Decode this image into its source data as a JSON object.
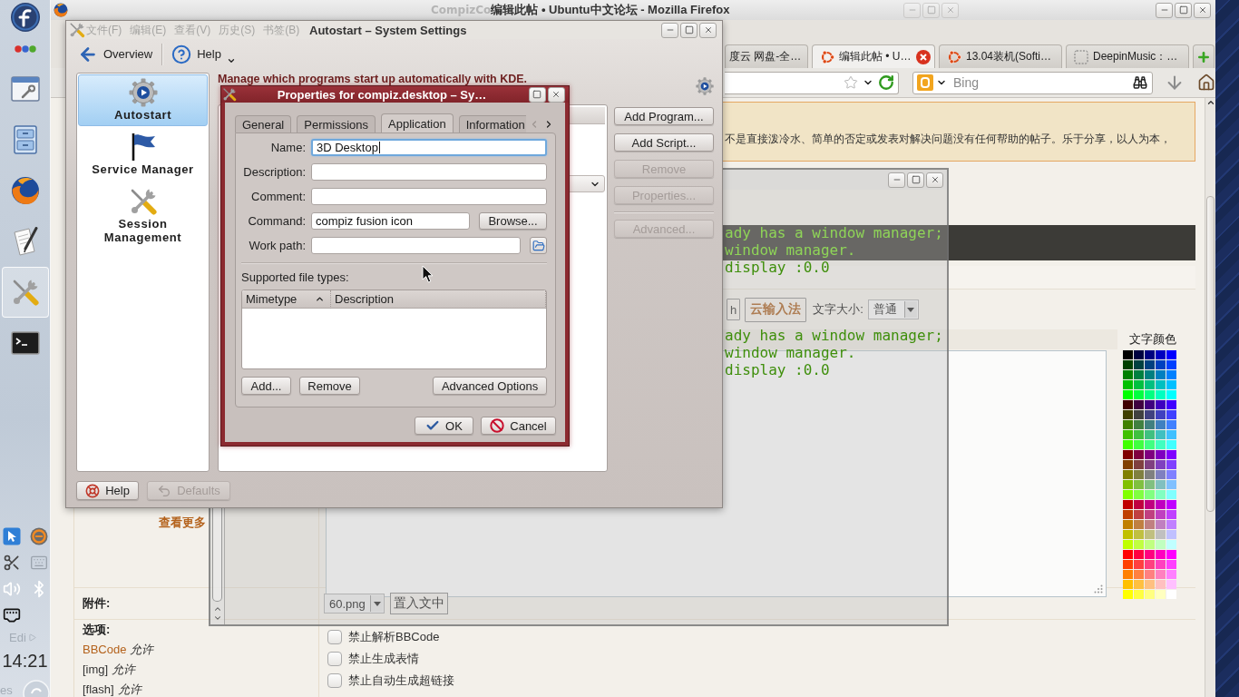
{
  "dock": {
    "launchers": [
      {
        "selected": false
      },
      {
        "selected": false
      },
      {
        "selected": false
      },
      {
        "selected": false
      },
      {
        "selected": true
      },
      {
        "selected": false
      }
    ],
    "faded_labels": [
      "Edi",
      "es"
    ],
    "clock": "14:21"
  },
  "firefox": {
    "ghost_title": "CompizCo",
    "title": "编辑此帖 • Ubuntu中文论坛 - Mozilla Firefox",
    "menu": [
      "文件(F)",
      "编辑(E)",
      "查看(V)",
      "历史(S)",
      "书签(B)"
    ],
    "tabs": [
      {
        "label": "度云 网盘-全…",
        "selected": false
      },
      {
        "label": "编辑此帖 • U…",
        "selected": true
      },
      {
        "label": "13.04装机(Softi…",
        "selected": false
      },
      {
        "label": "DeepinMusic：…",
        "selected": false
      }
    ],
    "search": {
      "placeholder": "Bing"
    },
    "page": {
      "notice": "不是直接泼冷水、简单的否定或发表对解决问题没有任何帮助的帖子。乐于分享，以人为本，",
      "more_link": "查看更多",
      "editor": {
        "toolbar_buttons": [
          {
            "label": "h",
            "kind": "plain"
          },
          {
            "label": "云输入法",
            "kind": "accent"
          }
        ],
        "font_size": {
          "label": "文字大小:",
          "value": "普通"
        },
        "color_label": "文字颜色",
        "swatches": [
          {
            "color": "#000000"
          },
          {
            "color": "#000040"
          },
          {
            "color": "#000080"
          },
          {
            "color": "#0000c0"
          },
          {
            "color": "#0000ff"
          },
          {
            "color": "#004000"
          },
          {
            "color": "#004040"
          },
          {
            "color": "#004080"
          },
          {
            "color": "#0040c0"
          },
          {
            "color": "#0040ff"
          },
          {
            "color": "#008000"
          },
          {
            "color": "#008040"
          },
          {
            "color": "#008080"
          },
          {
            "color": "#0080c0"
          },
          {
            "color": "#0080ff"
          },
          {
            "color": "#00c000"
          },
          {
            "color": "#00c040"
          },
          {
            "color": "#00c080"
          },
          {
            "color": "#00c0c0"
          },
          {
            "color": "#00c0ff"
          },
          {
            "color": "#00ff00"
          },
          {
            "color": "#00ff40"
          },
          {
            "color": "#00ff80"
          },
          {
            "color": "#00ffc0"
          },
          {
            "color": "#00ffff"
          },
          {
            "color": "#400000"
          },
          {
            "color": "#400040"
          },
          {
            "color": "#400080"
          },
          {
            "color": "#4000c0"
          },
          {
            "color": "#4000ff"
          },
          {
            "color": "#404000"
          },
          {
            "color": "#404040"
          },
          {
            "color": "#404080"
          },
          {
            "color": "#4040c0"
          },
          {
            "color": "#4040ff"
          },
          {
            "color": "#408000"
          },
          {
            "color": "#408040"
          },
          {
            "color": "#408080"
          },
          {
            "color": "#4080c0"
          },
          {
            "color": "#4080ff"
          },
          {
            "color": "#40c000"
          },
          {
            "color": "#40c040"
          },
          {
            "color": "#40c080"
          },
          {
            "color": "#40c0c0"
          },
          {
            "color": "#40c0ff"
          },
          {
            "color": "#40ff00"
          },
          {
            "color": "#40ff40"
          },
          {
            "color": "#40ff80"
          },
          {
            "color": "#40ffc0"
          },
          {
            "color": "#40ffff"
          },
          {
            "color": "#800000"
          },
          {
            "color": "#800040"
          },
          {
            "color": "#800080"
          },
          {
            "color": "#8000c0"
          },
          {
            "color": "#8000ff"
          },
          {
            "color": "#804000"
          },
          {
            "color": "#804040"
          },
          {
            "color": "#804080"
          },
          {
            "color": "#8040c0"
          },
          {
            "color": "#8040ff"
          },
          {
            "color": "#808000"
          },
          {
            "color": "#808040"
          },
          {
            "color": "#808080"
          },
          {
            "color": "#8080c0"
          },
          {
            "color": "#8080ff"
          },
          {
            "color": "#80c000"
          },
          {
            "color": "#80c040"
          },
          {
            "color": "#80c080"
          },
          {
            "color": "#80c0c0"
          },
          {
            "color": "#80c0ff"
          },
          {
            "color": "#80ff00"
          },
          {
            "color": "#80ff40"
          },
          {
            "color": "#80ff80"
          },
          {
            "color": "#80ffc0"
          },
          {
            "color": "#80ffff"
          },
          {
            "color": "#c00000"
          },
          {
            "color": "#c00040"
          },
          {
            "color": "#c00080"
          },
          {
            "color": "#c000c0"
          },
          {
            "color": "#c000ff"
          },
          {
            "color": "#c04000"
          },
          {
            "color": "#c04040"
          },
          {
            "color": "#c04080"
          },
          {
            "color": "#c040c0"
          },
          {
            "color": "#c040ff"
          },
          {
            "color": "#c08000"
          },
          {
            "color": "#c08040"
          },
          {
            "color": "#c08080"
          },
          {
            "color": "#c080c0"
          },
          {
            "color": "#c080ff"
          },
          {
            "color": "#c0c000"
          },
          {
            "color": "#c0c040"
          },
          {
            "color": "#c0c080"
          },
          {
            "color": "#c0c0c0"
          },
          {
            "color": "#c0c0ff"
          },
          {
            "color": "#c0ff00"
          },
          {
            "color": "#c0ff40"
          },
          {
            "color": "#c0ff80"
          },
          {
            "color": "#c0ffc0"
          },
          {
            "color": "#c0ffff"
          },
          {
            "color": "#ff0000"
          },
          {
            "color": "#ff0040"
          },
          {
            "color": "#ff0080"
          },
          {
            "color": "#ff00c0"
          },
          {
            "color": "#ff00ff"
          },
          {
            "color": "#ff4000"
          },
          {
            "color": "#ff4040"
          },
          {
            "color": "#ff4080"
          },
          {
            "color": "#ff40c0"
          },
          {
            "color": "#ff40ff"
          },
          {
            "color": "#ff8000"
          },
          {
            "color": "#ff8040"
          },
          {
            "color": "#ff8080"
          },
          {
            "color": "#ff80c0"
          },
          {
            "color": "#ff80ff"
          },
          {
            "color": "#ffc000"
          },
          {
            "color": "#ffc040"
          },
          {
            "color": "#ffc080"
          },
          {
            "color": "#ffc0c0"
          },
          {
            "color": "#ffc0ff"
          },
          {
            "color": "#ffff00"
          },
          {
            "color": "#ffff40"
          },
          {
            "color": "#ffff80"
          },
          {
            "color": "#ffffc0"
          },
          {
            "color": "#ffffff"
          }
        ]
      },
      "attachment": {
        "label": "附件:",
        "file": "60.png",
        "button": "置入文中"
      },
      "options": {
        "label": "选项:",
        "items": [
          {
            "tag": "BBCode",
            "status": "允许",
            "link": true
          },
          {
            "tag": "[img]",
            "status": "允许",
            "link": false
          },
          {
            "tag": "[flash]",
            "status": "允许",
            "link": false
          }
        ],
        "checkboxes": [
          {
            "label": "禁止解析BBCode",
            "checked": false
          },
          {
            "label": "禁止生成表情",
            "checked": false
          },
          {
            "label": "禁止自动生成超链接",
            "checked": false
          }
        ]
      }
    }
  },
  "terminal": {
    "text_blocks": [
      {
        "lines": [
          {
            "text": "ady has a window manager;",
            "dimmed": true
          },
          {
            "text": "window manager.",
            "dimmed": true
          },
          {
            "text": "display :0.0",
            "dimmed": false
          }
        ]
      },
      {
        "lines": [
          {
            "text": "ady has a window manager;",
            "dimmed": false
          },
          {
            "text": "window manager.",
            "dimmed": false
          },
          {
            "text": "display :0.0",
            "dimmed": false
          }
        ]
      }
    ]
  },
  "autostart": {
    "title": "Autostart – System Settings",
    "toolbar": [
      "Overview",
      "Help"
    ],
    "sidebar": [
      {
        "label": "Autostart",
        "selected": true
      },
      {
        "label": "Service Manager",
        "selected": false
      },
      {
        "label": "Session Management",
        "selected": false
      }
    ],
    "heading": "Manage which programs start up automatically with KDE.",
    "button_groups": [
      [
        {
          "label": "Add Program...",
          "disabled": false
        },
        {
          "label": "Add Script...",
          "disabled": false
        },
        {
          "label": "Remove",
          "disabled": true
        },
        {
          "label": "Properties...",
          "disabled": true
        }
      ],
      [
        {
          "label": "Advanced...",
          "disabled": true
        }
      ]
    ],
    "footer_buttons": [
      {
        "label": "Help",
        "disabled": false
      },
      {
        "label": "Defaults",
        "disabled": true
      }
    ]
  },
  "properties_dialog": {
    "title": "Properties for compiz.desktop – Sy…",
    "tabs": [
      {
        "label": "General",
        "selected": false
      },
      {
        "label": "Permissions",
        "selected": false
      },
      {
        "label": "Application",
        "selected": true
      },
      {
        "label": "Information",
        "selected": false
      }
    ],
    "tab_scroll": {
      "back_disabled": true,
      "forward_disabled": false
    },
    "fields": [
      {
        "kind": "text",
        "label": "Name:",
        "value": "3D Desktop",
        "focused": true
      },
      {
        "kind": "text",
        "label": "Description:",
        "focused": false
      },
      {
        "kind": "text",
        "label": "Comment:",
        "focused": false
      },
      {
        "kind": "browse",
        "label": "Command:",
        "value": "compiz fusion icon",
        "focused": false,
        "button": "Browse..."
      },
      {
        "kind": "folder",
        "label": "Work path:",
        "focused": false
      }
    ],
    "file_types": {
      "label": "Supported file types:",
      "columns": [
        {
          "label": "Mimetype",
          "sorted": true
        },
        {
          "label": "Description",
          "sorted": false
        }
      ],
      "buttons": [
        "Add...",
        "Remove",
        "Advanced Options"
      ]
    },
    "buttons": [
      "OK",
      "Cancel"
    ]
  }
}
